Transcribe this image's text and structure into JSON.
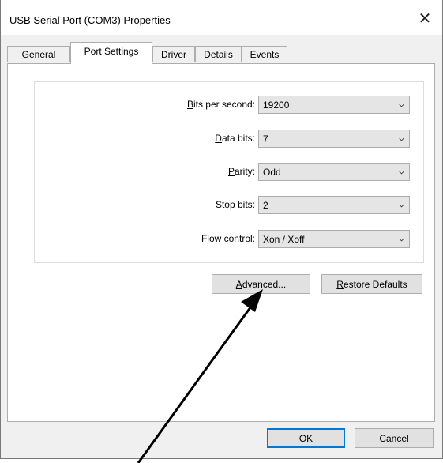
{
  "window": {
    "title": "USB Serial Port (COM3) Properties",
    "close_glyph": "✕"
  },
  "tabs": [
    {
      "label": "General"
    },
    {
      "label": "Port Settings"
    },
    {
      "label": "Driver"
    },
    {
      "label": "Details"
    },
    {
      "label": "Events"
    }
  ],
  "active_tab": "Port Settings",
  "settings": {
    "bits_per_second": {
      "label_pre": "",
      "label_key": "B",
      "label_post": "its per second:",
      "value": "19200"
    },
    "data_bits": {
      "label_pre": "",
      "label_key": "D",
      "label_post": "ata bits:",
      "value": "7"
    },
    "parity": {
      "label_pre": "",
      "label_key": "P",
      "label_post": "arity:",
      "value": "Odd"
    },
    "stop_bits": {
      "label_pre": "",
      "label_key": "S",
      "label_post": "top bits:",
      "value": "2"
    },
    "flow_control": {
      "label_pre": "",
      "label_key": "F",
      "label_post": "low control:",
      "value": "Xon / Xoff"
    }
  },
  "buttons": {
    "advanced": {
      "label_pre": "",
      "label_key": "A",
      "label_post": "dvanced..."
    },
    "restore_defaults": {
      "label_pre": "",
      "label_key": "R",
      "label_post": "estore Defaults"
    },
    "ok": "OK",
    "cancel": "Cancel"
  },
  "icons": {
    "dropdown": "chevron-down-icon",
    "annotation": "arrow-annotation-icon"
  },
  "colors": {
    "dialog_bg": "#f0f0f0",
    "page_bg": "#ffffff",
    "combo_bg": "#e5e5e5",
    "button_bg": "#e1e1e1",
    "focus_border": "#0078d7"
  }
}
